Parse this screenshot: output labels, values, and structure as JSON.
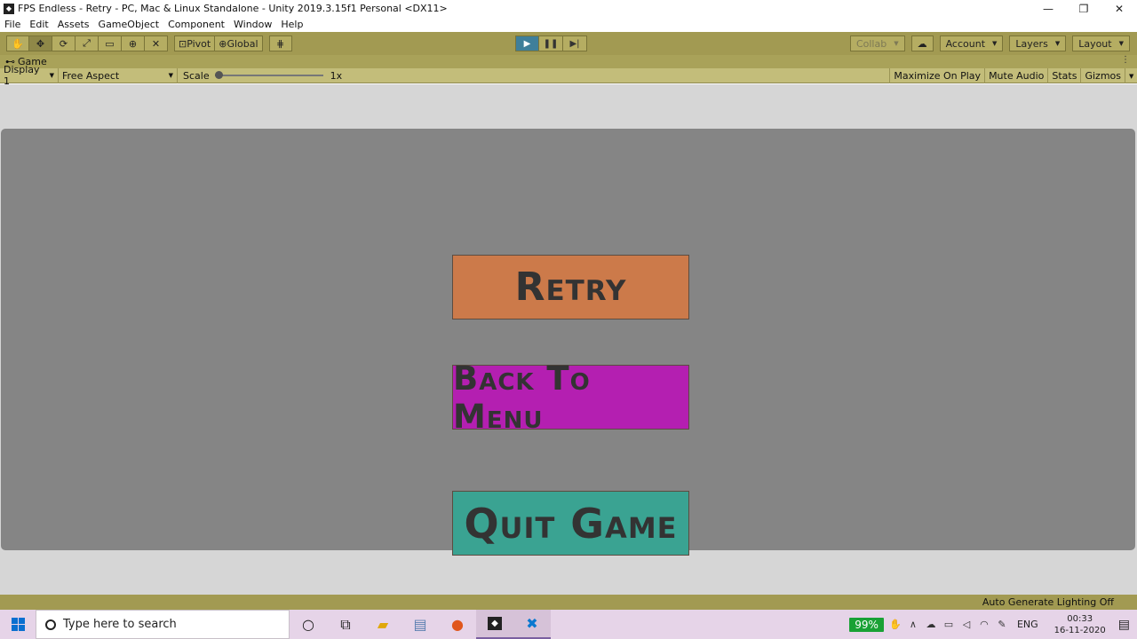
{
  "window": {
    "title": "FPS Endless - Retry - PC, Mac & Linux Standalone - Unity 2019.3.15f1 Personal <DX11>",
    "minimize": "—",
    "restore": "❐",
    "close": "✕"
  },
  "menu": {
    "items": [
      "File",
      "Edit",
      "Assets",
      "GameObject",
      "Component",
      "Window",
      "Help"
    ]
  },
  "toolbar": {
    "pivot_label": "Pivot",
    "global_label": "Global",
    "collab_label": "Collab",
    "account_label": "Account",
    "layers_label": "Layers",
    "layout_label": "Layout"
  },
  "game_tab": {
    "label": "Game",
    "display_label": "Display 1",
    "aspect_label": "Free Aspect",
    "scale_label": "Scale",
    "scale_value": "1x",
    "maximize_label": "Maximize On Play",
    "mute_label": "Mute Audio",
    "stats_label": "Stats",
    "gizmos_label": "Gizmos"
  },
  "game": {
    "retry_label": "Retry",
    "menu_label": "Back To Menu",
    "quit_label": "Quit Game"
  },
  "status": {
    "text": "Auto Generate Lighting Off"
  },
  "taskbar": {
    "search_placeholder": "Type here to search",
    "battery": "99%",
    "language": "ENG",
    "time": "00:33",
    "date": "16-11-2020"
  },
  "colors": {
    "toolbar": "#a29a52",
    "retry": "#cc7a4a",
    "menu": "#b41fb1",
    "quit": "#3aa392",
    "game_bg": "#858585"
  }
}
